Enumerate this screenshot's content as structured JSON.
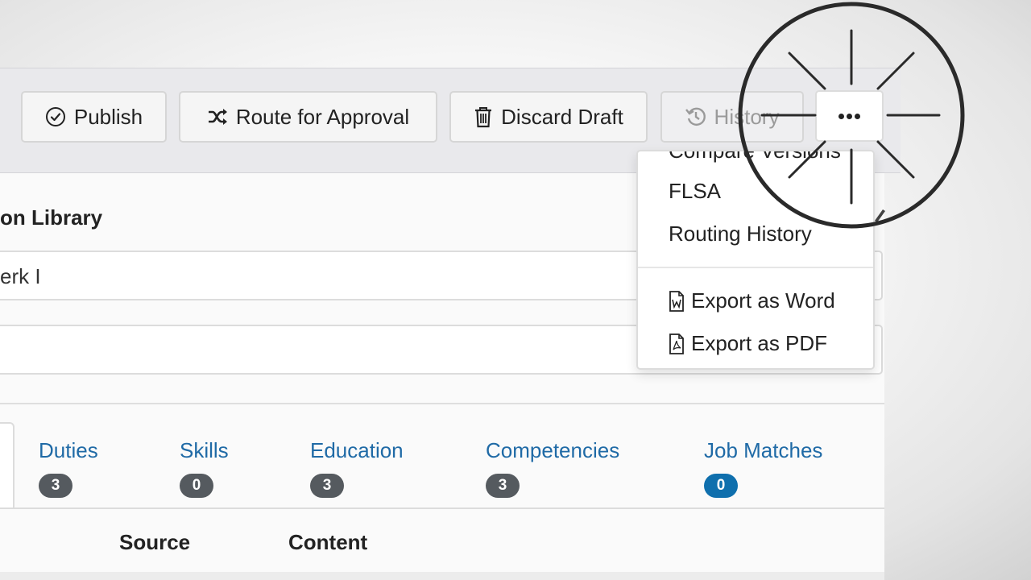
{
  "toolbar": {
    "publish_label": "Publish",
    "route_label": "Route for Approval",
    "discard_label": "Discard Draft",
    "history_label": "History"
  },
  "section": {
    "title": "on Library",
    "field_value": "erk I"
  },
  "tabs": [
    {
      "label": "Duties",
      "count": "3"
    },
    {
      "label": "Skills",
      "count": "0"
    },
    {
      "label": "Education",
      "count": "3"
    },
    {
      "label": "Competencies",
      "count": "3"
    },
    {
      "label": "Job Matches",
      "count": "0"
    }
  ],
  "table": {
    "columns": [
      "Source",
      "Content"
    ]
  },
  "menu": {
    "items": [
      "Compare Versions",
      "FLSA",
      "Routing History"
    ],
    "export_word": "Export as Word",
    "export_pdf": "Export as PDF"
  },
  "colors": {
    "tab_link": "#1f6aa6",
    "badge_gray": "#555a5f",
    "badge_blue": "#0f6fad"
  },
  "icons": [
    "check-circle-icon",
    "shuffle-icon",
    "trash-icon",
    "history-icon",
    "ellipsis-icon",
    "word-file-icon",
    "pdf-file-icon",
    "pencil-icon"
  ]
}
